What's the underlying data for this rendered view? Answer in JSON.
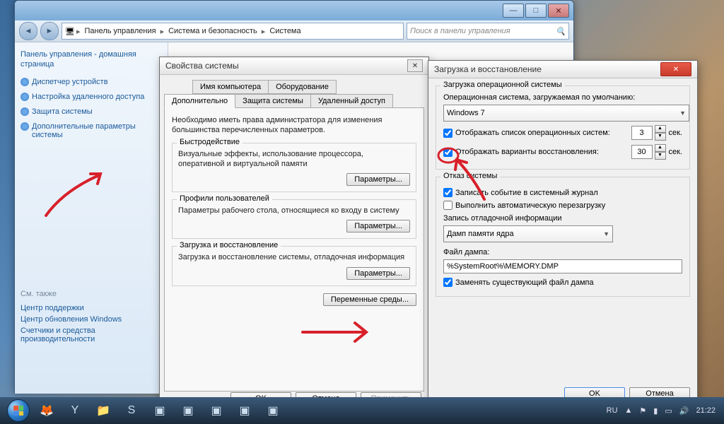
{
  "breadcrumb": {
    "b1": "Панель управления",
    "b2": "Система и безопасность",
    "b3": "Система"
  },
  "search": {
    "placeholder": "Поиск в панели управления"
  },
  "sidebar": {
    "home": "Панель управления - домашняя страница",
    "links": [
      "Диспетчер устройств",
      "Настройка удаленного доступа",
      "Защита системы",
      "Дополнительные параметры системы"
    ],
    "also": "См. также",
    "also_links": [
      "Центр поддержки",
      "Центр обновления Windows",
      "Счетчики и средства производительности"
    ]
  },
  "sysprop": {
    "title": "Свойства системы",
    "tabs_top": [
      "Имя компьютера",
      "Оборудование"
    ],
    "tabs_bottom": [
      "Дополнительно",
      "Защита системы",
      "Удаленный доступ"
    ],
    "note": "Необходимо иметь права администратора для изменения большинства перечисленных параметров.",
    "perf": {
      "title": "Быстродействие",
      "text": "Визуальные эффекты, использование процессора, оперативной и виртуальной памяти",
      "btn": "Параметры..."
    },
    "prof": {
      "title": "Профили пользователей",
      "text": "Параметры рабочего стола, относящиеся ко входу в систему",
      "btn": "Параметры..."
    },
    "start": {
      "title": "Загрузка и восстановление",
      "text": "Загрузка и восстановление системы, отладочная информация",
      "btn": "Параметры..."
    },
    "env": "Переменные среды...",
    "ok": "OK",
    "cancel": "Отмена",
    "apply": "Применить"
  },
  "startup": {
    "title": "Загрузка и восстановление",
    "boot_legend": "Загрузка операционной системы",
    "default_label": "Операционная система, загружаемая по умолчанию:",
    "default_value": "Windows 7",
    "show_os": "Отображать список операционных систем:",
    "show_os_sec": "3",
    "sec": "сек.",
    "show_rec": "Отображать варианты восстановления:",
    "show_rec_sec": "30",
    "fail_legend": "Отказ системы",
    "log_event": "Записать событие в системный журнал",
    "auto_restart": "Выполнить автоматическую перезагрузку",
    "debug_label": "Запись отладочной информации",
    "debug_value": "Дамп памяти ядра",
    "dump_label": "Файл дампа:",
    "dump_value": "%SystemRoot%\\MEMORY.DMP",
    "overwrite": "Заменять существующий файл дампа",
    "ok": "OK",
    "cancel": "Отмена"
  },
  "tray": {
    "lang": "RU",
    "time": "21:22"
  }
}
